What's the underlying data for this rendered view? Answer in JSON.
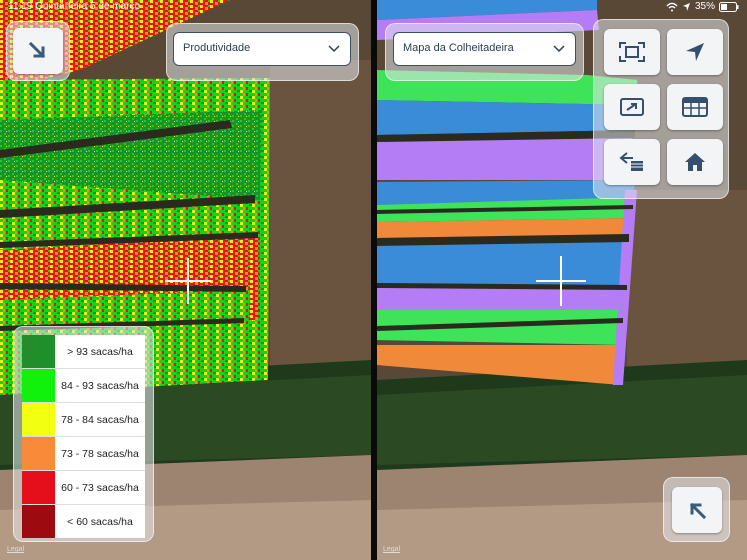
{
  "status_bar": {
    "time": "11:19",
    "date": "Quinta-feira 5 de março",
    "battery": "35%"
  },
  "left_pane": {
    "dropdown_value": "Produtividade",
    "legend": [
      {
        "label": "> 93 sacas/ha",
        "color": "#1e8f2a"
      },
      {
        "label": "84 - 93 sacas/ha",
        "color": "#10f20c"
      },
      {
        "label": "78 - 84 sacas/ha",
        "color": "#f2ff10"
      },
      {
        "label": "73 - 78 sacas/ha",
        "color": "#f98a3a"
      },
      {
        "label": "60 - 73 sacas/ha",
        "color": "#e40f1a"
      },
      {
        "label": "< 60 sacas/ha",
        "color": "#9d0b10"
      }
    ],
    "legal": "Legal"
  },
  "right_pane": {
    "dropdown_value": "Mapa da Colheitadeira",
    "tools": [
      {
        "icon": "fullscreen-icon"
      },
      {
        "icon": "location-arrow-icon"
      },
      {
        "icon": "export-image-icon"
      },
      {
        "icon": "table-icon"
      },
      {
        "icon": "layers-list-icon"
      },
      {
        "icon": "home-icon"
      }
    ],
    "legal": "Legal"
  },
  "colors": {
    "harvester_purple": "#b47df5",
    "harvester_blue": "#3a8bd8",
    "harvester_green": "#3fe35a",
    "harvester_orange": "#f08a3a"
  }
}
